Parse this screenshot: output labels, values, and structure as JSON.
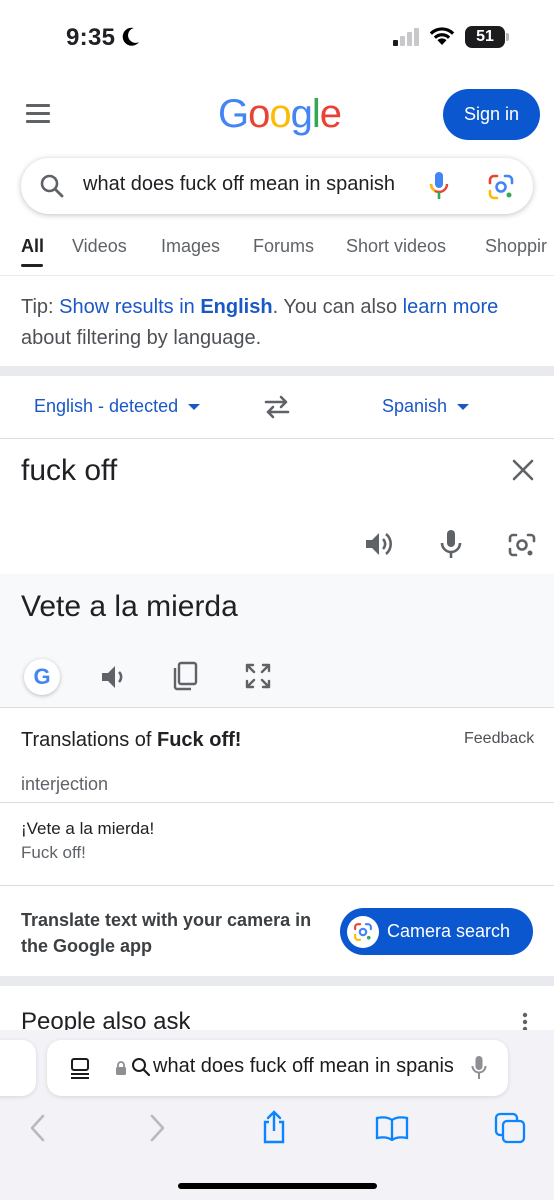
{
  "status": {
    "time": "9:35",
    "battery": "51",
    "battery_level": 0.51,
    "moon_icon": "moon-icon",
    "signal_icon": "cellular-signal-icon",
    "wifi_icon": "wifi-icon"
  },
  "header": {
    "logo_letters": [
      "G",
      "o",
      "o",
      "g",
      "l",
      "e"
    ],
    "logo_colors": [
      "#4285F4",
      "#EA4335",
      "#FBBC05",
      "#4285F4",
      "#34A853",
      "#EA4335"
    ],
    "signin_label": "Sign in",
    "accent": "#0b57d0"
  },
  "search": {
    "query": "what does fuck off mean in spanish"
  },
  "tabs": [
    {
      "label": "All",
      "active": true
    },
    {
      "label": "Videos",
      "active": false
    },
    {
      "label": "Images",
      "active": false
    },
    {
      "label": "Forums",
      "active": false
    },
    {
      "label": "Short videos",
      "active": false
    },
    {
      "label": "Shoppir",
      "active": false
    }
  ],
  "tip": {
    "prefix": "Tip: ",
    "link1": "Show results in ",
    "link1_bold": "English",
    "middle": ". You can also ",
    "link2": "learn more",
    "suffix": " about filtering by language."
  },
  "translator": {
    "source_lang": "English - detected",
    "target_lang": "Spanish",
    "source_text": "fuck off",
    "target_text": "Vete a la mierda",
    "g_badge": "G"
  },
  "translations": {
    "title_prefix": "Translations of ",
    "title_bold": "Fuck off!",
    "feedback": "Feedback",
    "part_of_speech": "interjection",
    "main": "¡Vete a la mierda!",
    "back": "Fuck off!"
  },
  "promo": {
    "text": "Translate text with your camera in the Google app",
    "button": "Camera search"
  },
  "paa": {
    "title": "People also ask"
  },
  "safari": {
    "address": "what does fuck off mean in spanish"
  }
}
